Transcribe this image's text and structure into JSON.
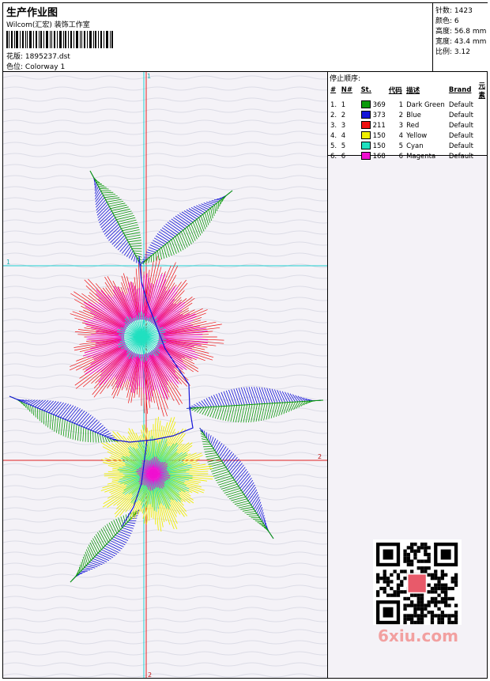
{
  "header": {
    "title": "生产作业图",
    "company": "Wilcom(汇宏) 装饰工作室",
    "design_label": "花版:",
    "design_value": "1895237.dst",
    "colorway_label": "色位:",
    "colorway_value": "Colorway 1"
  },
  "stats": [
    {
      "label": "针数:",
      "value": "1423"
    },
    {
      "label": "颜色:",
      "value": "6"
    },
    {
      "label": "高度:",
      "value": "56.8 mm"
    },
    {
      "label": "宽度:",
      "value": "43.4 mm"
    },
    {
      "label": "比例:",
      "value": "3.12"
    }
  ],
  "stop_sequence": {
    "heading": "停止顺序:",
    "columns": [
      "#",
      "N#",
      "St.",
      "代码",
      "描述",
      "Brand",
      "元素"
    ],
    "rows": [
      {
        "index": "1.",
        "n": "1",
        "color": "#0a9a0a",
        "stitches": "369",
        "code": "1",
        "description": "Dark Green",
        "brand": "Default"
      },
      {
        "index": "2.",
        "n": "2",
        "color": "#1414d8",
        "stitches": "373",
        "code": "2",
        "description": "Blue",
        "brand": "Default"
      },
      {
        "index": "3.",
        "n": "3",
        "color": "#ee1010",
        "stitches": "211",
        "code": "3",
        "description": "Red",
        "brand": "Default"
      },
      {
        "index": "4.",
        "n": "4",
        "color": "#f0f000",
        "stitches": "150",
        "code": "4",
        "description": "Yellow",
        "brand": "Default"
      },
      {
        "index": "5.",
        "n": "5",
        "color": "#20e0c0",
        "stitches": "150",
        "code": "5",
        "description": "Cyan",
        "brand": "Default"
      },
      {
        "index": "6.",
        "n": "6",
        "color": "#f010d0",
        "stitches": "168",
        "code": "6",
        "description": "Magenta",
        "brand": "Default"
      }
    ]
  },
  "guides": {
    "v1_label": "1",
    "v2_label": "2",
    "h1_label": "1",
    "h2_label": "2"
  },
  "watermark": "6xiu.com"
}
